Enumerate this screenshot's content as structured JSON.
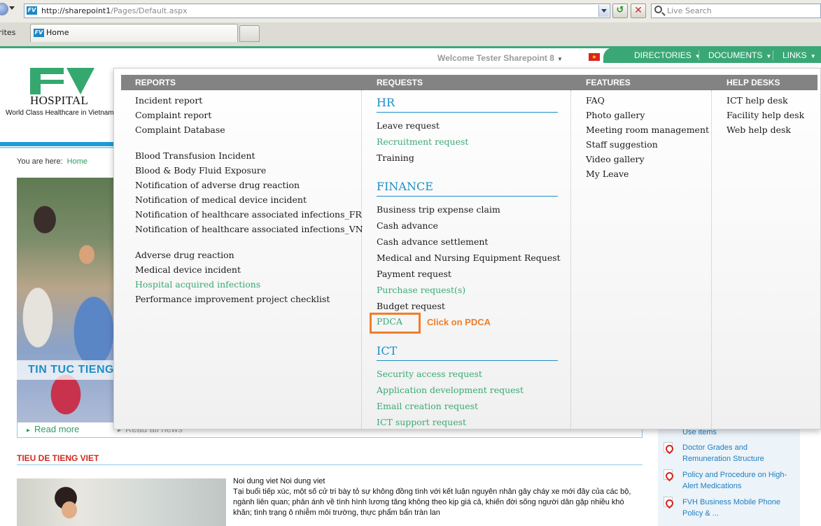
{
  "browser": {
    "url_host": "http://sharepoint1",
    "url_path": "/Pages/Default.aspx",
    "search_placeholder": "Live Search",
    "favorites_label": "rites",
    "tab_title": "Home",
    "favicon_text": "FV"
  },
  "header": {
    "welcome": "Welcome Tester Sharepoint 8",
    "nav": [
      "DIRECTORIES",
      "DOCUMENTS",
      "LINKS"
    ],
    "logo_text": "HOSPITAL",
    "tagline": "World Class Healthcare in Vietnam",
    "brand_color": "#3aa876",
    "accent_blue": "#1b8fc7"
  },
  "breadcrumb": {
    "label": "You are here:",
    "home": "Home"
  },
  "hero": {
    "caption": "TIN TUC TIENG",
    "read_more": "Read more",
    "read_all": "Read all news"
  },
  "news": {
    "section_title": "TIEU DE TIENG VIET",
    "headline": "Noi dung viet Noi dung viet",
    "body": "Tại buổi tiếp xúc, một số cử tri bày tỏ sự không đồng tình với kết luận nguyên nhân gây cháy xe mới đây của các bộ, ngành liên quan; phản ánh về tình hình lương tăng không theo kịp giá cả, khiến đời sống người dân gặp nhiều khó khăn; tình trạng ô nhiễm môi trường, thực phẩm bẩn tràn lan"
  },
  "documents": [
    "Use items",
    "Doctor Grades and Remuneration Structure",
    "Policy and Procedure on High-Alert Medications",
    "FVH Business Mobile Phone Policy & ..."
  ],
  "menu": {
    "headers": [
      "REPORTS",
      "REQUESTS",
      "FEATURES",
      "HELP DESKS"
    ],
    "reports": {
      "group1": [
        "Incident report",
        "Complaint report",
        "Complaint Database"
      ],
      "group2": [
        "Blood Transfusion Incident",
        "Blood & Body Fluid Exposure",
        "Notification of adverse drug reaction",
        "Notification of medical device incident",
        "Notification of healthcare associated infections_FR",
        "Notification of healthcare associated infections_VN"
      ],
      "group3": [
        "Adverse drug reaction",
        "Medical device incident",
        "Hospital acquired infections",
        "Performance improvement project checklist"
      ]
    },
    "requests": {
      "hr_title": "HR",
      "hr": [
        "Leave request",
        "Recruitment request",
        "Training"
      ],
      "finance_title": "FINANCE",
      "finance": [
        "Business trip expense claim",
        "Cash advance",
        "Cash advance settlement",
        "Medical and Nursing Equipment Request",
        "Payment request",
        "Purchase request(s)",
        "Budget request",
        "PDCA"
      ],
      "ict_title": "ICT",
      "ict": [
        "Security access request",
        "Application development request",
        "Email creation request",
        "ICT support request"
      ]
    },
    "features": [
      "FAQ",
      "Photo gallery",
      "Meeting room management",
      "Staff suggestion",
      "Video gallery",
      "My Leave"
    ],
    "helpdesks": [
      "ICT help desk",
      "Facility help desk",
      "Web help desk"
    ],
    "annotation": "Click on PDCA",
    "annotation_color": "#f07e2a"
  }
}
